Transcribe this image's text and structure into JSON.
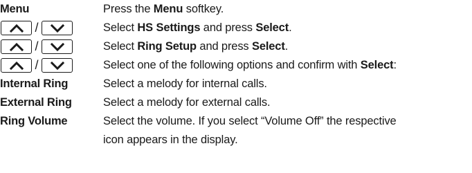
{
  "rows": [
    {
      "term": "Menu",
      "desc": {
        "pre": "Press the ",
        "b1": "Menu",
        "post": " softkey."
      }
    },
    {
      "separator": "/",
      "desc": {
        "pre": "Select ",
        "b1": "HS Settings",
        "mid": " and press ",
        "b2": "Select",
        "post": "."
      }
    },
    {
      "separator": "/",
      "desc": {
        "pre": "Select ",
        "b1": "Ring Setup",
        "mid": " and press ",
        "b2": "Select",
        "post": "."
      }
    },
    {
      "separator": "/",
      "desc": {
        "pre": "Select one of the following options and confirm with ",
        "b1": "Select",
        "post": ":"
      }
    },
    {
      "term": "Internal Ring",
      "desc": {
        "text": "Select a melody for internal calls."
      }
    },
    {
      "term": "External Ring",
      "desc": {
        "text": "Select a melody for external calls."
      }
    },
    {
      "term": "Ring Volume",
      "desc": {
        "line1": "Select the volume. If you select “Volume Off” the respective",
        "line2": "icon appears in the display."
      }
    }
  ],
  "icons": {
    "up": "chevron-up-icon",
    "down": "chevron-down-icon"
  }
}
